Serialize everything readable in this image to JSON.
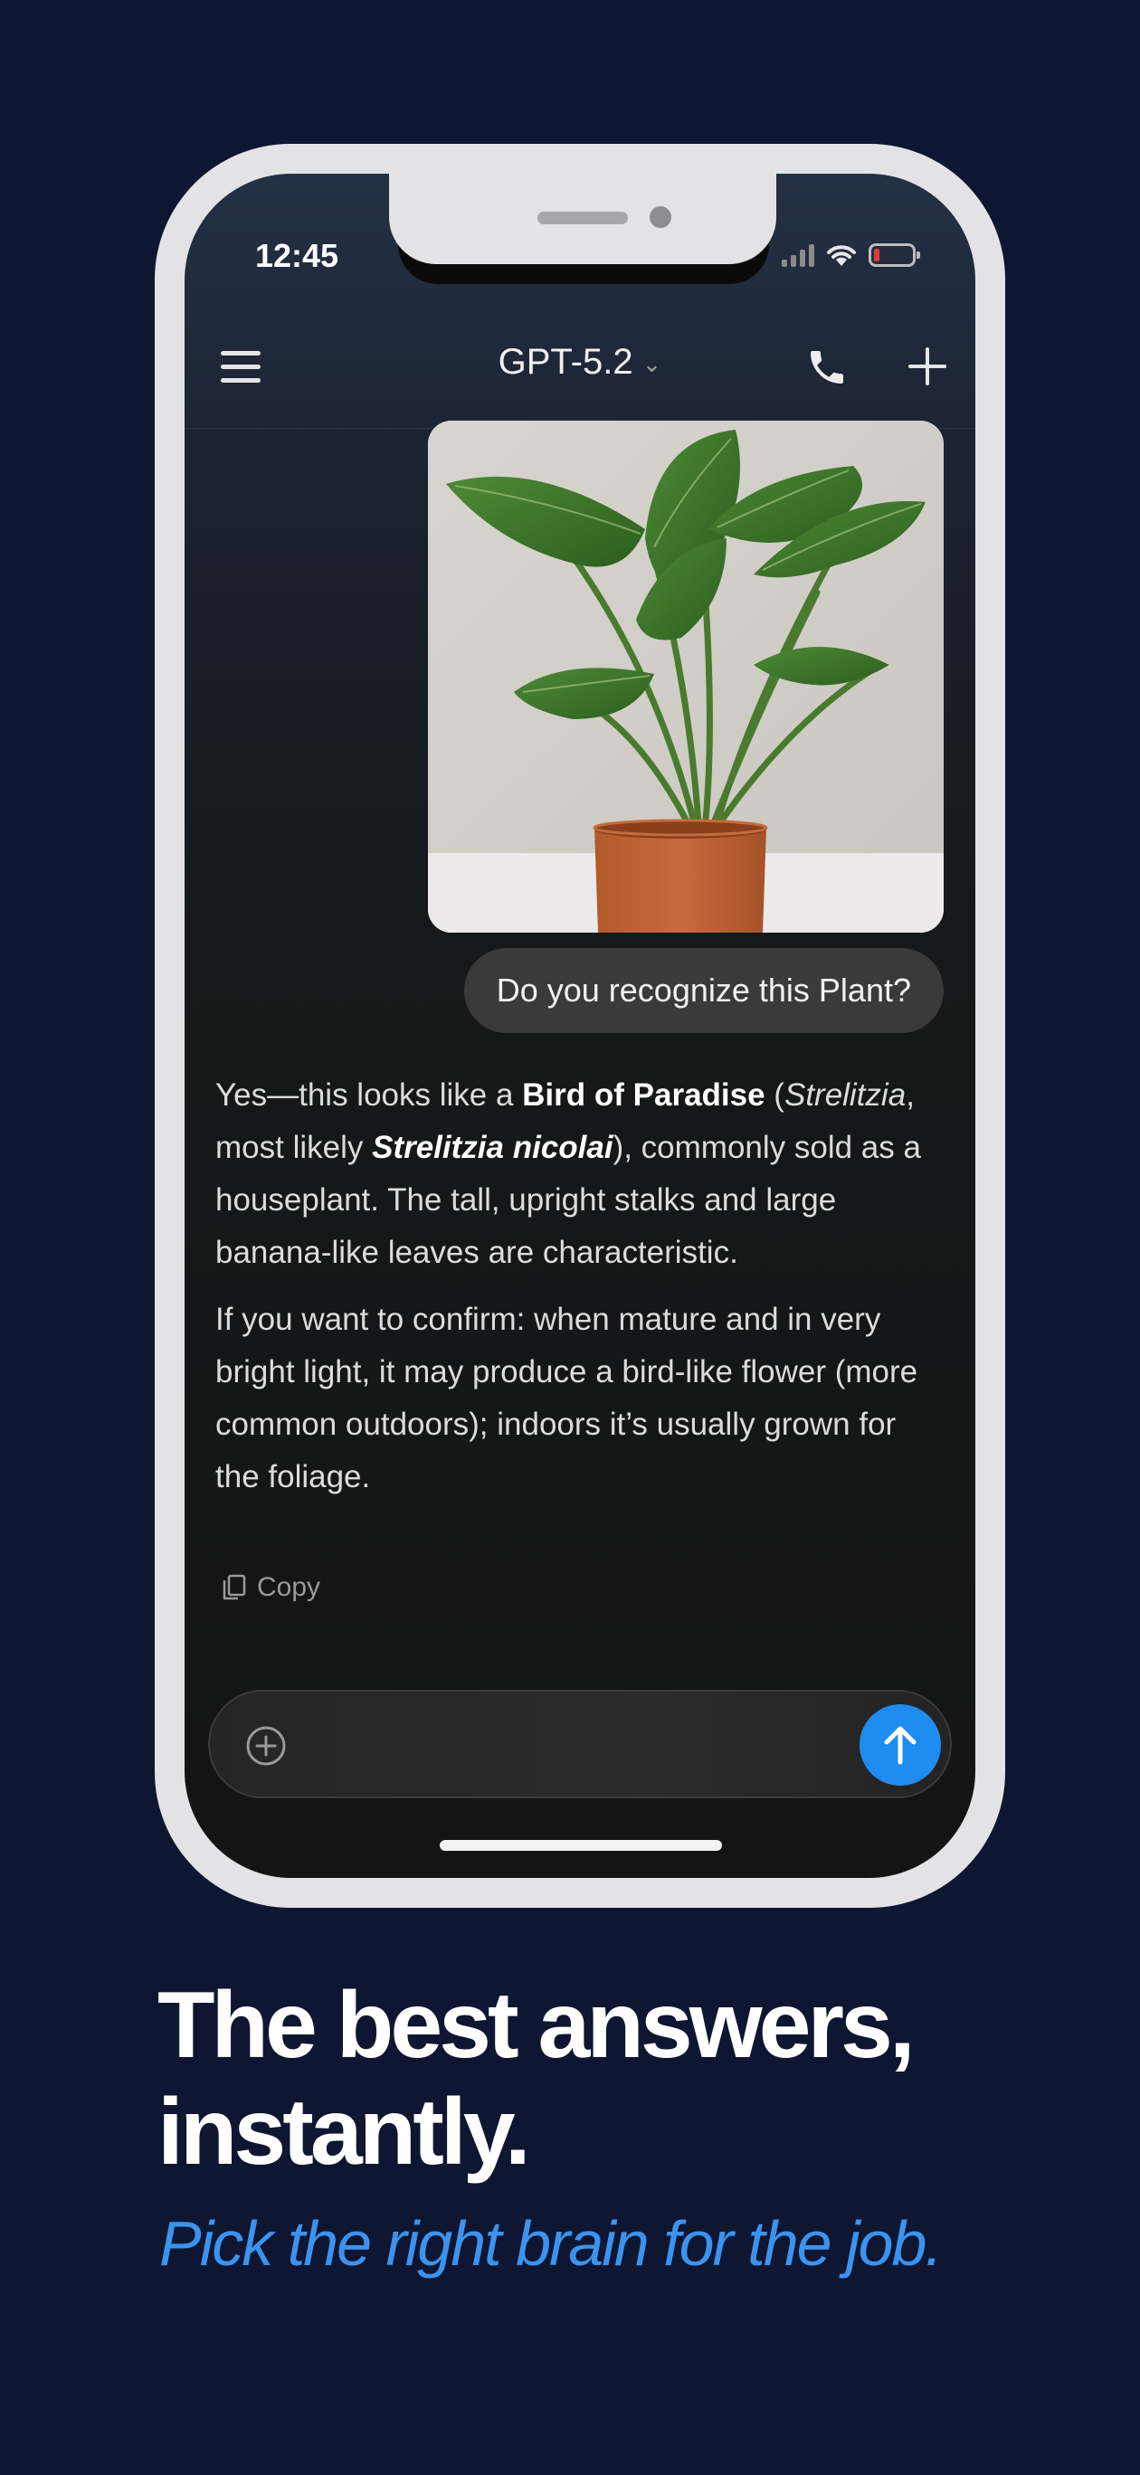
{
  "status": {
    "time": "12:45"
  },
  "header": {
    "model": "GPT-5.2"
  },
  "chat": {
    "user_message": "Do you recognize this Plant?",
    "assistant": {
      "p1": [
        {
          "text": "Yes—this looks like a ",
          "style": "normal"
        },
        {
          "text": "Bird of Paradise",
          "style": "bold"
        },
        {
          "text": " (",
          "style": "normal"
        },
        {
          "text": "Strelitzia",
          "style": "italic"
        },
        {
          "text": ", most likely ",
          "style": "normal"
        },
        {
          "text": "Strelitzia nicolai",
          "style": "bold-italic"
        },
        {
          "text": "), commonly sold as a houseplant. The tall, upright stalks and large banana-like leaves are characteristic.",
          "style": "normal"
        }
      ],
      "p2": "If you want to confirm: when mature and in very bright light, it may produce a bird-like flower (more common outdoors); indoors it’s usually grown for the foliage."
    },
    "copy_label": "Copy"
  },
  "composer": {
    "placeholder": ""
  },
  "marketing": {
    "headline_line1": "The best answers,",
    "headline_line2": "instantly.",
    "tagline": "Pick the right brain for the job."
  },
  "colors": {
    "background": "#0e1631",
    "accent": "#1e8cf0",
    "tagline": "#3b93ef"
  },
  "icons": [
    "menu-icon",
    "chevron-down-icon",
    "phone-icon",
    "plus-icon",
    "copy-icon",
    "add-circle-icon",
    "arrow-up-icon",
    "wifi-icon",
    "signal-icon",
    "battery-icon"
  ]
}
